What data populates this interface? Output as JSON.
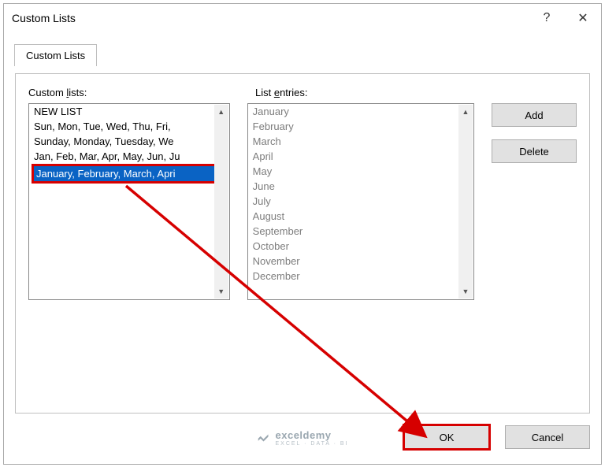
{
  "titlebar": {
    "title": "Custom Lists",
    "help": "?",
    "close": "✕"
  },
  "tabs": {
    "main": "Custom Lists"
  },
  "labels": {
    "custom_lists_pre": "Custom ",
    "custom_lists_u": "l",
    "custom_lists_post": "ists:",
    "list_entries_pre": "List ",
    "list_entries_u": "e",
    "list_entries_post": "ntries:"
  },
  "custom_lists": {
    "items": [
      "NEW LIST",
      "Sun, Mon, Tue, Wed, Thu, Fri,",
      "Sunday, Monday, Tuesday, We",
      "Jan, Feb, Mar, Apr, May, Jun, Ju"
    ],
    "selected": "January, February, March, Apri"
  },
  "list_entries": {
    "items": [
      "January",
      "February",
      "March",
      "April",
      "May",
      "June",
      "July",
      "August",
      "September",
      "October",
      "November",
      "December"
    ]
  },
  "buttons": {
    "add": "Add",
    "delete": "Delete",
    "ok": "OK",
    "cancel": "Cancel"
  },
  "scroll": {
    "up": "▲",
    "down": "▼"
  },
  "watermark": {
    "brand": "exceldemy",
    "sub": "EXCEL · DATA · BI"
  },
  "annotation": {
    "color": "#d60000"
  }
}
